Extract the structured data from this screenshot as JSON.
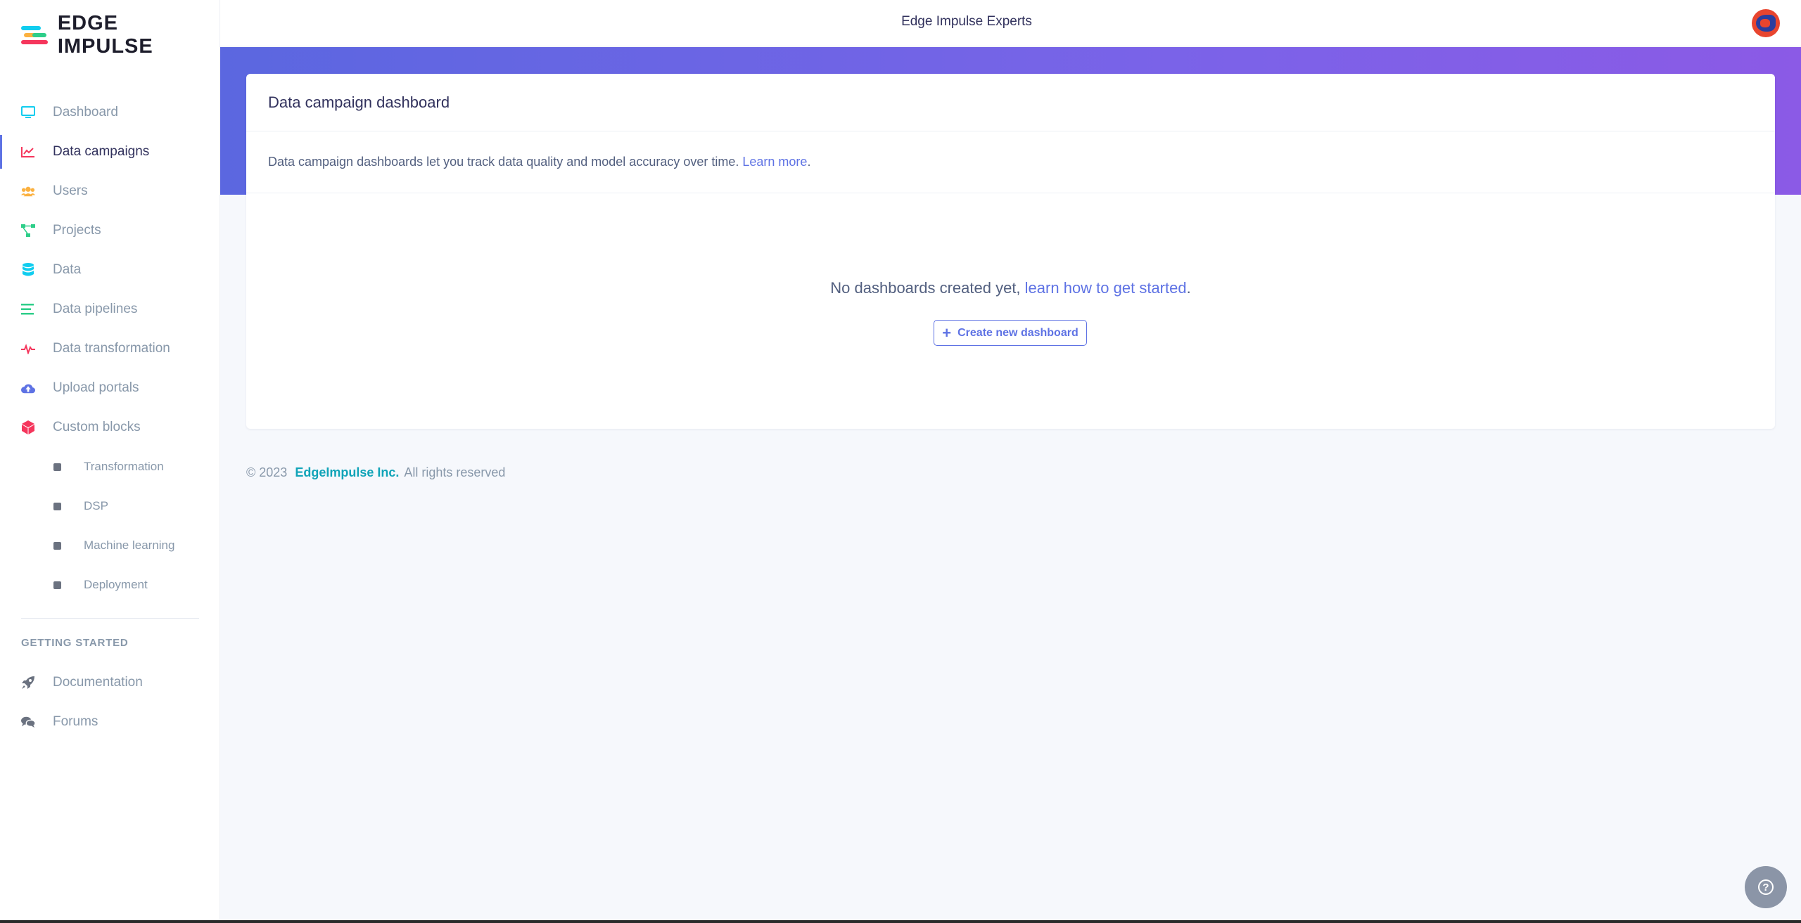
{
  "brand": {
    "logo_text": "EDGE IMPULSE"
  },
  "topbar": {
    "org_name": "Edge Impulse Experts"
  },
  "sidebar": {
    "items": [
      {
        "label": "Dashboard",
        "icon": "monitor-icon",
        "color": "#11cdef"
      },
      {
        "label": "Data campaigns",
        "icon": "chart-line-icon",
        "color": "#f5365c",
        "active": true
      },
      {
        "label": "Users",
        "icon": "users-icon",
        "color": "#fbb140"
      },
      {
        "label": "Projects",
        "icon": "project-diagram-icon",
        "color": "#2dce89"
      },
      {
        "label": "Data",
        "icon": "database-icon",
        "color": "#11cdef"
      },
      {
        "label": "Data pipelines",
        "icon": "list-icon",
        "color": "#2dce89"
      },
      {
        "label": "Data transformation",
        "icon": "heartbeat-icon",
        "color": "#f5365c"
      },
      {
        "label": "Upload portals",
        "icon": "cloud-upload-icon",
        "color": "#5e72e4"
      },
      {
        "label": "Custom blocks",
        "icon": "cube-icon",
        "color": "#f5365c"
      }
    ],
    "sub_items": [
      {
        "label": "Transformation"
      },
      {
        "label": "DSP"
      },
      {
        "label": "Machine learning"
      },
      {
        "label": "Deployment"
      }
    ],
    "section_heading": "GETTING STARTED",
    "getting_started": [
      {
        "label": "Documentation",
        "icon": "rocket-icon"
      },
      {
        "label": "Forums",
        "icon": "comments-icon"
      }
    ]
  },
  "card": {
    "title": "Data campaign dashboard",
    "description": "Data campaign dashboards let you track data quality and model accuracy over time.",
    "learn_more": "Learn more",
    "empty_text": "No dashboards created yet,",
    "empty_link": "learn how to get started",
    "create_button": "Create new dashboard"
  },
  "footer": {
    "copyright": "© 2023",
    "company": "EdgeImpulse Inc.",
    "rights": "All rights reserved"
  },
  "help": {
    "glyph": "?"
  },
  "colors": {
    "accent": "#5e72e4",
    "banner_start": "#5b67e0",
    "banner_end": "#8b5ae6",
    "footer_company": "#11a4b8"
  }
}
